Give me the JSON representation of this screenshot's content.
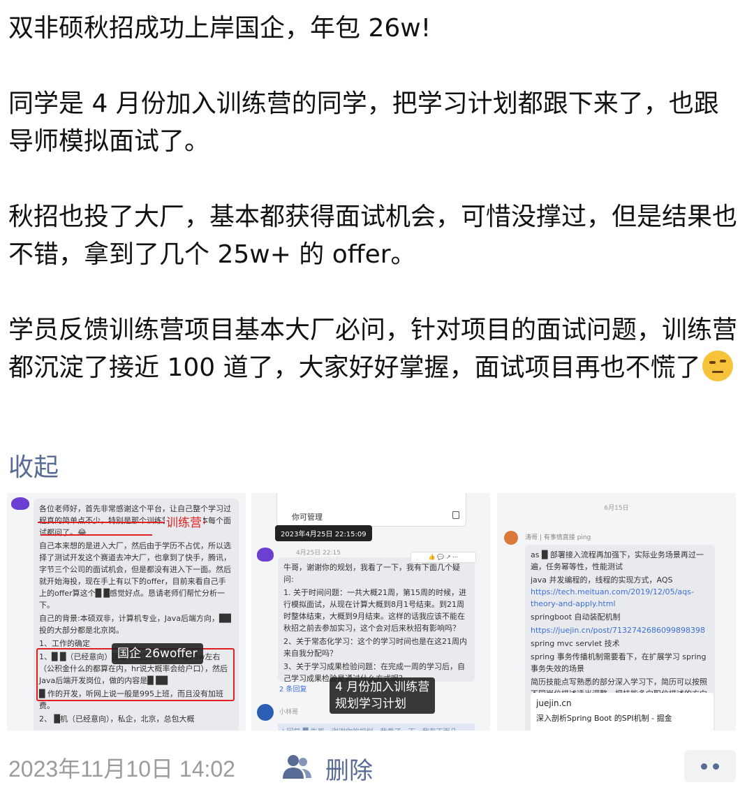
{
  "post": {
    "paragraphs": [
      "双非硕秋招成功上岸国企，年包 26w!",
      "同学是 4 月份加入训练营的同学，把学习计划都跟下来了，也跟导师模拟面试了。",
      "秋招也投了大厂，基本都获得面试机会，可惜没撑过，但是结果也不错，拿到了几个 25w+ 的 offer。",
      "学员反馈训练营项目基本大厂必问，针对项目的面试问题，训练营都沉淀了接近 100 道了，大家好好掌握，面试项目再也不慌了"
    ],
    "emoji": "thinking-face-icon",
    "collapse_label": "收起"
  },
  "thumbs": {
    "t1": {
      "red_label": "训练营",
      "lines": [
        "各位老师好，首先非常感谢这个平台，让自己整个学习过程真的简单点不少，特别是那个训练营项目，基本每个面试都问了。😂",
        "自己本来想的是进入大厂，然后由于学历不占优，所以选择了测试开发这个赛道去冲大厂，也拿到了快手，腾讯，字节三个公司的面试机会，但是都没有进入下一面。然后就开始海投，现在手上有以下的offer，目前来看自己手上的offer算这个█ █感觉好点。恳请老师们帮忙分析一下。",
        "自己的背景:本硕双非，计算机专业，Java后端方向，██ 投的大部分都是北京岗。",
        "1、工作的确定",
        "1、█ █（已经意向）国企，北京，总包大概26w左右（公积金什么的都算在内，hr说大概率会给户口），然后Java后端开发岗位，做的内容是█ ██",
        "█ 作的开发，听网上说一般是995上班，而且没有加班费。",
        "2、 █机（已经意向），私企，北京，总包大概"
      ],
      "tip": "国企 26woffer"
    },
    "t2": {
      "manage": "你可管理",
      "tooltip": "2023年4月25日 22:15:09",
      "date": "4月25日 22:15",
      "toolbar": "👍 💬 ↗ ⋯",
      "lines": [
        "牛哥，谢谢你的规划，我看了一下，我有下面几个疑问:",
        "1. 关于时间问题：一共大概21周，第15周的时候，进行模拟面试，从现在计算大概到8月1号结束。到21周时整体结束，大概到9月结束。这样的话我应该不能在秋招之前去参加实习，这个会对后来秋招有影响吗？",
        "2、关于常态化学习：这个的学习时间也是在这21周内来自我分配吗？",
        "3、关于学习成果检验问题：在完成一周的学习后，自己学习成果检验是通过什么方式呢？"
      ],
      "replies": "2 条回复",
      "tip": "4 月份加入训练营\n规划学习计划",
      "name": "小林哥",
      "quote": "| 回复 █ 牛哥，谢谢你的规划，我看了一下，我有下面几"
    },
    "t3": {
      "date": "6月15日",
      "name": "涛哥 | 有事情直接 ping",
      "lines": [
        "as █ 部署接入流程再加强下，实际业务场景再过一遍，任务幂等性，性能测试",
        "java 并发编程的，线程的实现方式，AQS",
        "springboot 自动装配机制",
        "spring mvc servlet 技术",
        "spring 事务传播机制需要看下，在扩展学习 spring 事务失效的场景",
        "简历技能点写熟悉的部分深入学习下，简历可以按照不同岗位描述适当调整，把技能多向职位描述的方向靠"
      ],
      "link1": "https://tech.meituan.com/2019/12/05/aqs-theory-and-apply.html",
      "link2": "https://juejin.cn/post/7132742686099898398",
      "card_site": "juejin.cn",
      "card_title": "深入剖析Spring Boot 的SPI机制 - 掘金"
    }
  },
  "footer": {
    "timestamp": "2023年11月10日 14:02",
    "group_icon": "visibility-group-icon",
    "delete_label": "删除",
    "more_icon": "more-dots-icon"
  },
  "colors": {
    "link": "#576b95",
    "highlight_red": "#e02020",
    "timestamp_gray": "#9b9b9b"
  }
}
